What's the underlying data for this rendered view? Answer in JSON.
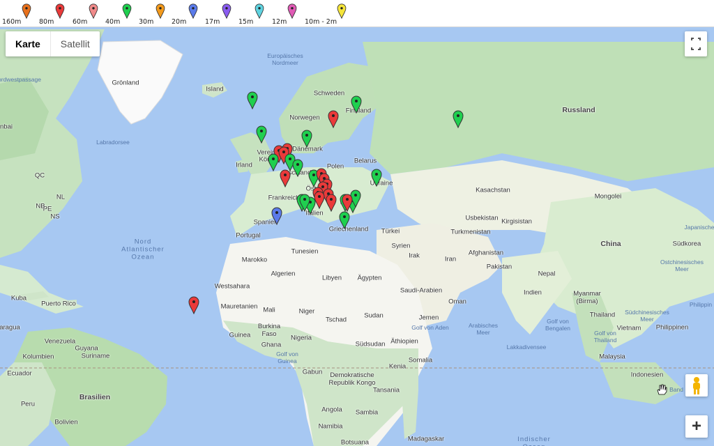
{
  "legend": [
    {
      "label": "160m",
      "color": "#e8711c"
    },
    {
      "label": "80m",
      "color": "#ea3a3a"
    },
    {
      "label": "60m",
      "color": "#f08a8a"
    },
    {
      "label": "40m",
      "color": "#1fcf4f"
    },
    {
      "label": "30m",
      "color": "#f39a1c"
    },
    {
      "label": "20m",
      "color": "#5b7bea"
    },
    {
      "label": "17m",
      "color": "#8a5cf0"
    },
    {
      "label": "15m",
      "color": "#5fd3e0"
    },
    {
      "label": "12m",
      "color": "#e05ab5"
    },
    {
      "label": "10m - 2m",
      "color": "#f5e53a"
    }
  ],
  "map_type": {
    "karte": "Karte",
    "satellit": "Satellit"
  },
  "zoom_in_label": "+",
  "labels": {
    "groenland": "Grönland",
    "island": "Island",
    "nordwestpassage": "ordwestpassage",
    "labradorsee": "Labradorsee",
    "europ_nordmeer": "Europäisches\nNordmeer",
    "schweden": "Schweden",
    "finnland": "Finnland",
    "norwegen": "Norwegen",
    "russland": "Russland",
    "daenemark": "Dänemark",
    "vereinigtes": "Vereinigtes",
    "koenigreich": "Kön",
    "irland": "Irland",
    "belarus": "Belarus",
    "polen": "Polen",
    "deutschland": "schland",
    "ukraine": "Ukraine",
    "oesterreich": "Öst",
    "frankreich": "Frankreich",
    "italien": "Italien",
    "rumaenien": "R",
    "griechenland": "Griechenland",
    "spanien": "Spanien",
    "portugal": "Portugal",
    "tuerkei": "Türkei",
    "kasachstan": "Kasachstan",
    "mongolei": "Mongolei",
    "usbekistan": "Usbekistan",
    "kirgisistan": "Kirgisistan",
    "turkmenistan": "Turkmenistan",
    "china": "China",
    "suedkorea": "Südkorea",
    "japanische": "Japanische",
    "ostchin": "Ostchinesisches\nMeer",
    "syrien": "Syrien",
    "irak": "Irak",
    "iran": "Iran",
    "afghanistan": "Afghanistan",
    "pakistan": "Pakistan",
    "nepal": "Nepal",
    "indien": "Indien",
    "myanmar": "Myanmar\n(Birma)",
    "thailand": "Thailand",
    "vietnam": "Vietnam",
    "philippinen": "Philippinen",
    "philippinen_sea": "Philippin",
    "suedchin": "Südchinesisches\nMeer",
    "golf_bengalen": "Golf von\nBengalen",
    "golf_thailand": "Golf von\nThailand",
    "malaysia": "Malaysia",
    "indonesien": "Indonesien",
    "banda": "Band",
    "lakkadiven": "Lakkadivensee",
    "arab_meer": "Arabisches\nMeer",
    "saudi": "Saudi-Arabien",
    "oman": "Oman",
    "jemen": "Jemen",
    "golf_aden": "Golf von Aden",
    "somalia": "Somalia",
    "aethiopien": "Äthiopien",
    "kenia": "Kenia",
    "tansania": "Tansania",
    "suedsudan": "Südsudan",
    "sudan": "Sudan",
    "tschad": "Tschad",
    "niger": "Niger",
    "nigeria": "Nigeria",
    "aegypten": "Ägypten",
    "libyen": "Libyen",
    "algerien": "Algerien",
    "tunesien": "Tunesien",
    "marokko": "Marokko",
    "westsahara": "Westsahara",
    "mauretanien": "Mauretanien",
    "mali": "Mali",
    "burkina": "Burkina\nFaso",
    "guinea": "Guinea",
    "ghana": "Ghana",
    "golf_guinea": "Golf von\nGuinea",
    "gabun": "Gabun",
    "dr_kongo": "Demokratische\nRepublik Kongo",
    "angola": "Angola",
    "sambia": "Sambia",
    "namibia": "Namibia",
    "botsuana": "Botsuana",
    "madagaskar": "Madagaskar",
    "indischer": "Indischer\nOzean",
    "nord_atlantik": "Nord\nAtlantischer\nOzean",
    "kuba": "Kuba",
    "puerto_rico": "Puerto Rico",
    "aragua": "aragua",
    "venezuela": "Venezuela",
    "guyana": "Guyana",
    "suriname": "Suriname",
    "kolumbien": "Kolumbien",
    "ecuador": "Ecuador",
    "peru": "Peru",
    "brasilien": "Brasilien",
    "bolivien": "Bolivien",
    "nbai": "nbai",
    "qc": "QC",
    "nl": "NL",
    "pe": "PE",
    "nb": "NB",
    "ns": "NS"
  },
  "markers": [
    {
      "color": "#1fcf4f",
      "band": "40m"
    },
    {
      "color": "#1fcf4f",
      "band": "40m"
    },
    {
      "color": "#ea3a3a",
      "band": "80m"
    },
    {
      "color": "#1fcf4f",
      "band": "40m"
    },
    {
      "color": "#1fcf4f",
      "band": "40m"
    },
    {
      "color": "#1fcf4f",
      "band": "40m"
    },
    {
      "color": "#ea3a3a",
      "band": "80m"
    },
    {
      "color": "#ea3a3a",
      "band": "80m"
    },
    {
      "color": "#ea3a3a",
      "band": "80m"
    },
    {
      "color": "#1fcf4f",
      "band": "40m"
    },
    {
      "color": "#1fcf4f",
      "band": "40m"
    },
    {
      "color": "#1fcf4f",
      "band": "40m"
    },
    {
      "color": "#ea3a3a",
      "band": "80m"
    },
    {
      "color": "#1fcf4f",
      "band": "40m"
    },
    {
      "color": "#1fcf4f",
      "band": "40m"
    },
    {
      "color": "#1fcf4f",
      "band": "40m"
    },
    {
      "color": "#ea3a3a",
      "band": "80m"
    },
    {
      "color": "#ea3a3a",
      "band": "80m"
    },
    {
      "color": "#ea3a3a",
      "band": "80m"
    },
    {
      "color": "#ea3a3a",
      "band": "80m"
    },
    {
      "color": "#ea3a3a",
      "band": "80m"
    },
    {
      "color": "#ea3a3a",
      "band": "80m"
    },
    {
      "color": "#ea3a3a",
      "band": "80m"
    },
    {
      "color": "#1fcf4f",
      "band": "40m"
    },
    {
      "color": "#1fcf4f",
      "band": "40m"
    },
    {
      "color": "#1fcf4f",
      "band": "40m"
    },
    {
      "color": "#ea3a3a",
      "band": "80m"
    },
    {
      "color": "#ea3a3a",
      "band": "80m"
    },
    {
      "color": "#1fcf4f",
      "band": "40m"
    },
    {
      "color": "#1fcf4f",
      "band": "40m"
    },
    {
      "color": "#1fcf4f",
      "band": "40m"
    },
    {
      "color": "#5b7bea",
      "band": "20m"
    },
    {
      "color": "#ea3a3a",
      "band": "80m"
    }
  ]
}
